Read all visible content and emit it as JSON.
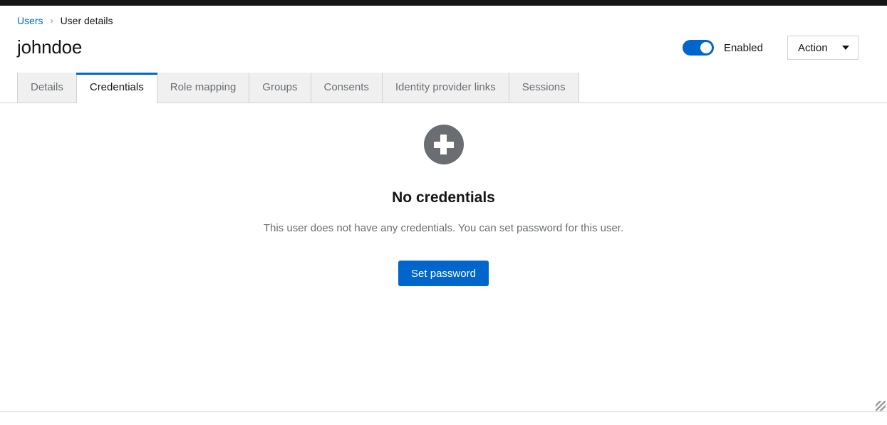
{
  "breadcrumb": {
    "parent": "Users",
    "separator": "›",
    "current": "User details"
  },
  "header": {
    "title": "johndoe",
    "toggle": {
      "label": "Enabled",
      "state": "on",
      "color": "#0066cc"
    },
    "action_dropdown": {
      "label": "Action"
    }
  },
  "tabs": [
    {
      "label": "Details",
      "active": false
    },
    {
      "label": "Credentials",
      "active": true
    },
    {
      "label": "Role mapping",
      "active": false
    },
    {
      "label": "Groups",
      "active": false
    },
    {
      "label": "Consents",
      "active": false
    },
    {
      "label": "Identity provider links",
      "active": false
    },
    {
      "label": "Sessions",
      "active": false
    }
  ],
  "empty_state": {
    "icon": "plus-circle-icon",
    "icon_color": "#6a6e73",
    "title": "No credentials",
    "description": "This user does not have any credentials. You can set password for this user.",
    "button_label": "Set password",
    "button_color": "#0066cc"
  }
}
